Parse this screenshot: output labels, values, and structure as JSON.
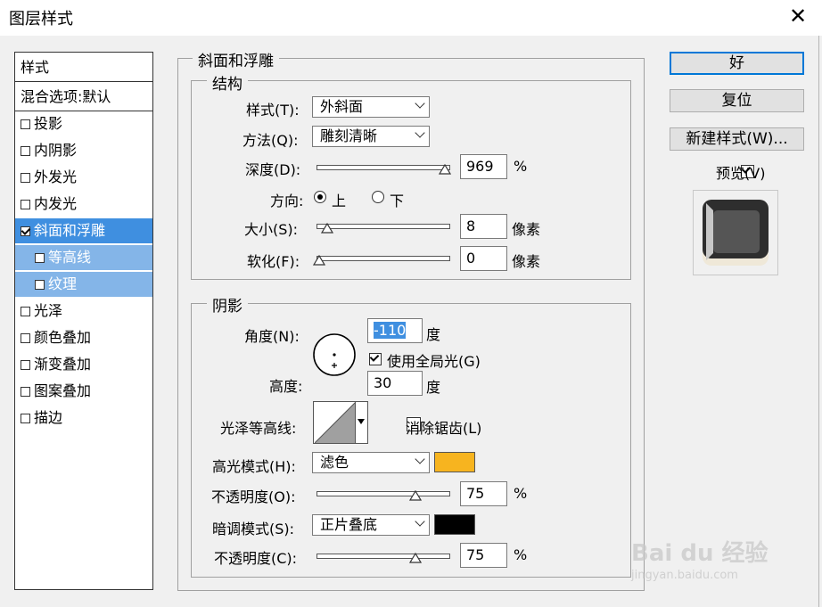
{
  "window": {
    "title": "图层样式"
  },
  "style_list": {
    "header": "样式",
    "blend_options": "混合选项:默认",
    "items": [
      {
        "label": "投影",
        "checked": false
      },
      {
        "label": "内阴影",
        "checked": false
      },
      {
        "label": "外发光",
        "checked": false
      },
      {
        "label": "内发光",
        "checked": false
      },
      {
        "label": "斜面和浮雕",
        "checked": true
      },
      {
        "label": "等高线",
        "checked": false
      },
      {
        "label": "纹理",
        "checked": false
      },
      {
        "label": "光泽",
        "checked": false
      },
      {
        "label": "颜色叠加",
        "checked": false
      },
      {
        "label": "渐变叠加",
        "checked": false
      },
      {
        "label": "图案叠加",
        "checked": false
      },
      {
        "label": "描边",
        "checked": false
      }
    ]
  },
  "bevel": {
    "group_title": "斜面和浮雕",
    "structure": {
      "title": "结构",
      "style_label": "样式(T):",
      "style_value": "外斜面",
      "technique_label": "方法(Q):",
      "technique_value": "雕刻清晰",
      "depth_label": "深度(D):",
      "depth_value": "969",
      "depth_unit": "%",
      "depth_slider": 0.98,
      "direction_label": "方向:",
      "direction_up": "上",
      "direction_down": "下",
      "direction_selected": "up",
      "size_label": "大小(S):",
      "size_value": "8",
      "size_unit": "像素",
      "size_slider": 0.06,
      "soften_label": "软化(F):",
      "soften_value": "0",
      "soften_unit": "像素",
      "soften_slider": 0.0
    },
    "shading": {
      "title": "阴影",
      "angle_label": "角度(N):",
      "angle_value": "-110",
      "angle_unit": "度",
      "global_light_label": "使用全局光(G)",
      "global_light_checked": true,
      "altitude_label": "高度:",
      "altitude_value": "30",
      "altitude_unit": "度",
      "gloss_contour_label": "光泽等高线:",
      "antialias_label": "消除锯齿(L)",
      "antialias_checked": false,
      "highlight_mode_label": "高光模式(H):",
      "highlight_mode_value": "滤色",
      "highlight_color": "#f7b41f",
      "highlight_opacity_label": "不透明度(O):",
      "highlight_opacity_value": "75",
      "highlight_opacity_unit": "%",
      "highlight_opacity_slider": 0.75,
      "shadow_mode_label": "暗调模式(S):",
      "shadow_mode_value": "正片叠底",
      "shadow_color": "#000000",
      "shadow_opacity_label": "不透明度(C):",
      "shadow_opacity_value": "75",
      "shadow_opacity_unit": "%",
      "shadow_opacity_slider": 0.75
    }
  },
  "buttons": {
    "ok": "好",
    "reset": "复位",
    "new_style": "新建样式(W)..."
  },
  "preview": {
    "label": "预览(V)",
    "checked": true
  },
  "watermark": {
    "text": "Bai du 经验",
    "sub": "jingyan.baidu.com"
  }
}
